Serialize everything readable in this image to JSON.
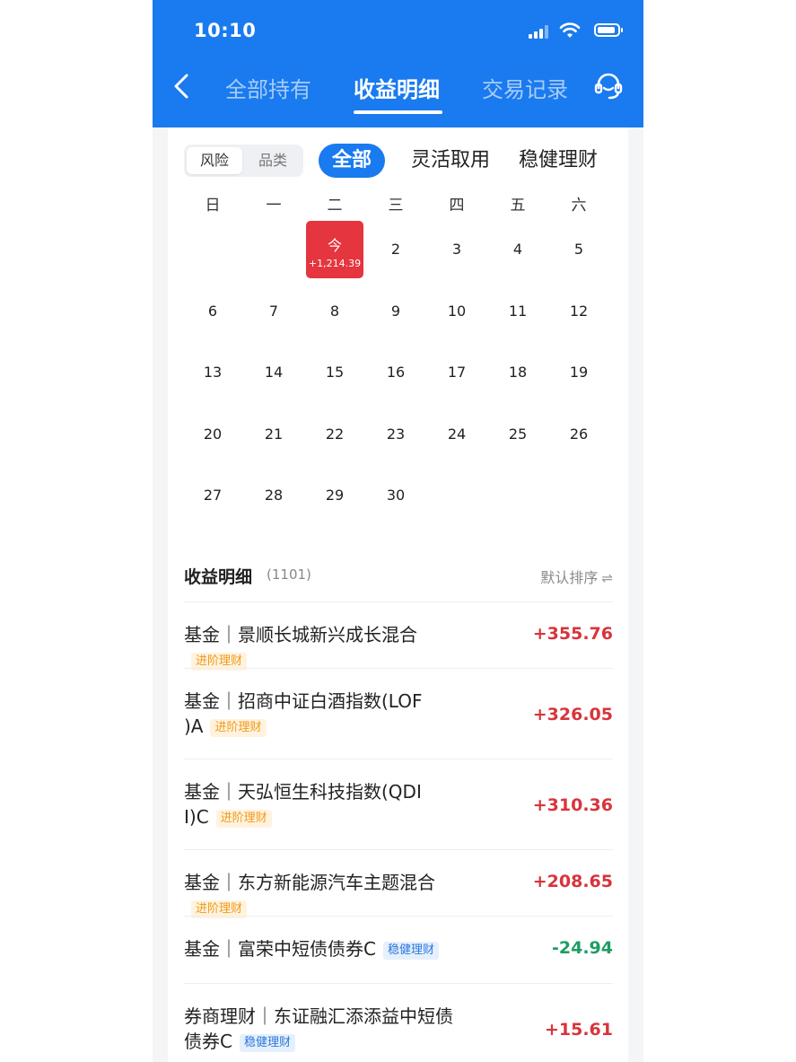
{
  "status_bar": {
    "time": "10:10"
  },
  "nav": {
    "tabs": [
      {
        "label": "全部持有"
      },
      {
        "label": "收益明细"
      },
      {
        "label": "交易记录"
      }
    ]
  },
  "filters": {
    "segment": [
      "风险",
      "品类"
    ],
    "chips": [
      "全部",
      "灵活取用",
      "稳健理财"
    ]
  },
  "calendar": {
    "weekdays": [
      "日",
      "一",
      "二",
      "三",
      "四",
      "五",
      "六"
    ],
    "today_label": "今",
    "today_value": "+1,214.39",
    "days": [
      "2",
      "3",
      "4",
      "5",
      "6",
      "7",
      "8",
      "9",
      "10",
      "11",
      "12",
      "13",
      "14",
      "15",
      "16",
      "17",
      "18",
      "19",
      "20",
      "21",
      "22",
      "23",
      "24",
      "25",
      "26",
      "27",
      "28",
      "29",
      "30"
    ]
  },
  "detail": {
    "title": "收益明细",
    "count": "(1101)",
    "sort_label": "默认排序",
    "sort_icon": "⇌"
  },
  "rows": [
    {
      "line1": "基金｜景顺长城新兴成长混合",
      "line2": "",
      "tag": "进阶理财",
      "amount": "+355.76"
    },
    {
      "line1": "基金｜招商中证白酒指数(LOF",
      "line2": ")A",
      "tag": "进阶理财",
      "amount": "+326.05"
    },
    {
      "line1": "基金｜天弘恒生科技指数(QDI",
      "line2": "I)C",
      "tag": "进阶理财",
      "amount": "+310.36"
    },
    {
      "line1": "基金｜东方新能源汽车主题混合",
      "line2": "",
      "tag": "进阶理财",
      "amount": "+208.65"
    },
    {
      "line1": "基金｜富荣中短债债券C",
      "line2": "",
      "tag": "稳健理财",
      "amount": "-24.94"
    },
    {
      "line1": "券商理财｜东证融汇添添益中短债",
      "line2": "债券C",
      "tag": "稳健理财",
      "amount": "+15.61"
    }
  ]
}
